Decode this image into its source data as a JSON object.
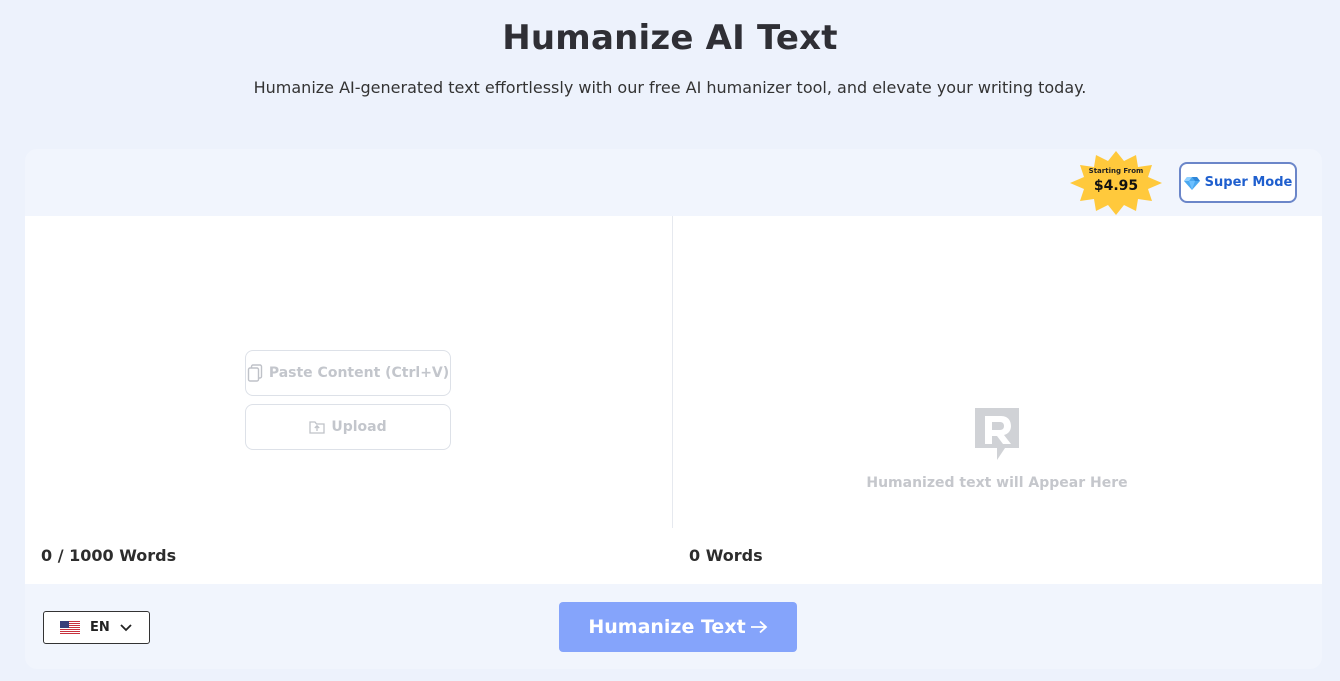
{
  "hero": {
    "title": "Humanize AI Text",
    "subtitle": "Humanize AI-generated text effortlessly with our free AI humanizer tool, and elevate your writing today."
  },
  "pricing_badge": {
    "label": "Starting From",
    "price": "$4.95",
    "color": "#ffc93c"
  },
  "super_mode": {
    "label": "Super Mode",
    "icon": "diamond-icon"
  },
  "input_panel": {
    "paste_label": "Paste Content (Ctrl+V)",
    "paste_icon": "copy-icon",
    "upload_label": "Upload",
    "upload_icon": "upload-folder-icon",
    "word_count": "0 / 1000 Words"
  },
  "output_panel": {
    "logo_icon": "r-logo-icon",
    "placeholder": "Humanized text will Appear Here",
    "word_count": "0 Words"
  },
  "language": {
    "selected": "EN",
    "flag_icon": "us-flag-icon"
  },
  "actions": {
    "humanize_label": "Humanize Text",
    "arrow_icon": "arrow-right-icon",
    "accent": "#85a4fb"
  }
}
